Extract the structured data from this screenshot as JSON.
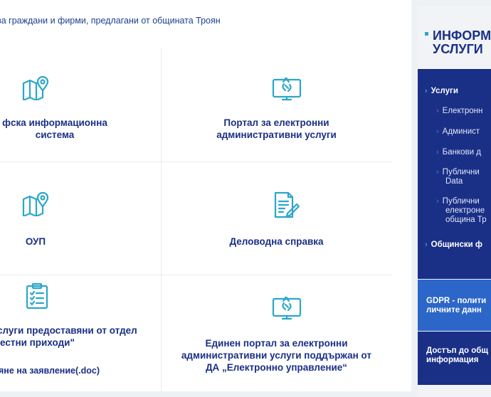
{
  "intro_text": "за граждани и фирми, предлагани от общината Троян",
  "cards": [
    {
      "title_l1": "фска информационна",
      "title_l2": "система",
      "icon": "map-pin-icon"
    },
    {
      "title_l1": "Портал за електронни",
      "title_l2": "административни услуги",
      "icon": "monitor-link-icon"
    },
    {
      "title_l1": "ОУП",
      "icon": "map-pin-icon"
    },
    {
      "title_l1": "Деловодна справка",
      "icon": "document-edit-icon"
    },
    {
      "title_l1": "слуги предоставяни от отдел",
      "title_l2": "естни приходи\"",
      "link": "яне на заявление(.doc)",
      "icon": "clipboard-checklist-icon"
    },
    {
      "title_l1": "Единен портал за електронни",
      "title_l2": "административни услуги поддържан от",
      "title_l3": "ДА „Електронно управление“",
      "icon": "monitor-link-icon"
    }
  ],
  "sidebar": {
    "heading_l1": "ИНФОРМ",
    "heading_l2": "УСЛУГИ",
    "nav": [
      {
        "label": "Услуги"
      },
      {
        "label": "Електронн"
      },
      {
        "label": "Админист"
      },
      {
        "label": "Банкови д"
      },
      {
        "label_l1": "Публични",
        "label_l2": "Data"
      },
      {
        "label_l1": "Публични",
        "label_l2": "електроне",
        "label_l3": "община Тр"
      },
      {
        "label": "Общински ф"
      }
    ],
    "gdpr_l1": "GDPR - полити",
    "gdpr_l2": "личните данн",
    "access_l1": "Достъп до общ",
    "access_l2": "информация"
  },
  "colors": {
    "accent": "#2aa7c9",
    "navy": "#1a2f86",
    "blue": "#2b66c8"
  }
}
